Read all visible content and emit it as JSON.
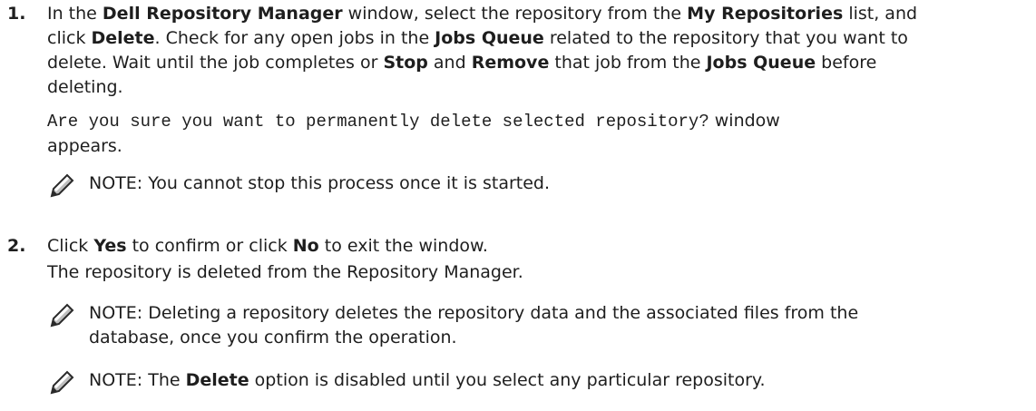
{
  "step1": {
    "number": "1.",
    "p1": {
      "t1": "In the ",
      "b1": "Dell Repository Manager",
      "t2": " window, select the repository from the ",
      "b2": "My Repositories",
      "t3": " list, and",
      "t4": "click ",
      "b3": "Delete",
      "t5": ". Check for any open jobs in the ",
      "b4": "Jobs Queue",
      "t6": " related to the repository that you want to",
      "t7": "delete. Wait until the job completes or ",
      "b5": "Stop",
      "t8": " and ",
      "b6": "Remove",
      "t9": " that job from the ",
      "b7": "Jobs Queue",
      "t10": " before",
      "t11": "deleting."
    },
    "p2": {
      "mono": "Are you sure you want to permanently delete selected repository?",
      "t1": " window",
      "t2": "appears."
    },
    "note": {
      "icon": "note-pencil-icon",
      "label": "NOTE:",
      "text": " You cannot stop this process once it is started."
    }
  },
  "step2": {
    "number": "2.",
    "p1": {
      "t1": "Click ",
      "b1": "Yes",
      "t2": " to confirm or click ",
      "b2": "No",
      "t3": " to exit the window."
    },
    "p2": "The repository is deleted from the Repository Manager.",
    "note1": {
      "icon": "note-pencil-icon",
      "label": "NOTE:",
      "line1": " Deleting a repository deletes the repository data and the associated files from the",
      "line2": "database, once you confirm the operation."
    },
    "note2": {
      "icon": "note-pencil-icon",
      "label": "NOTE:",
      "t1": " The ",
      "b1": "Delete",
      "t2": " option is disabled until you select any particular repository."
    }
  },
  "colors": {
    "text": "#1e1e1e",
    "icon_dark": "#2a2a2a",
    "icon_light": "#bfbfbf"
  }
}
